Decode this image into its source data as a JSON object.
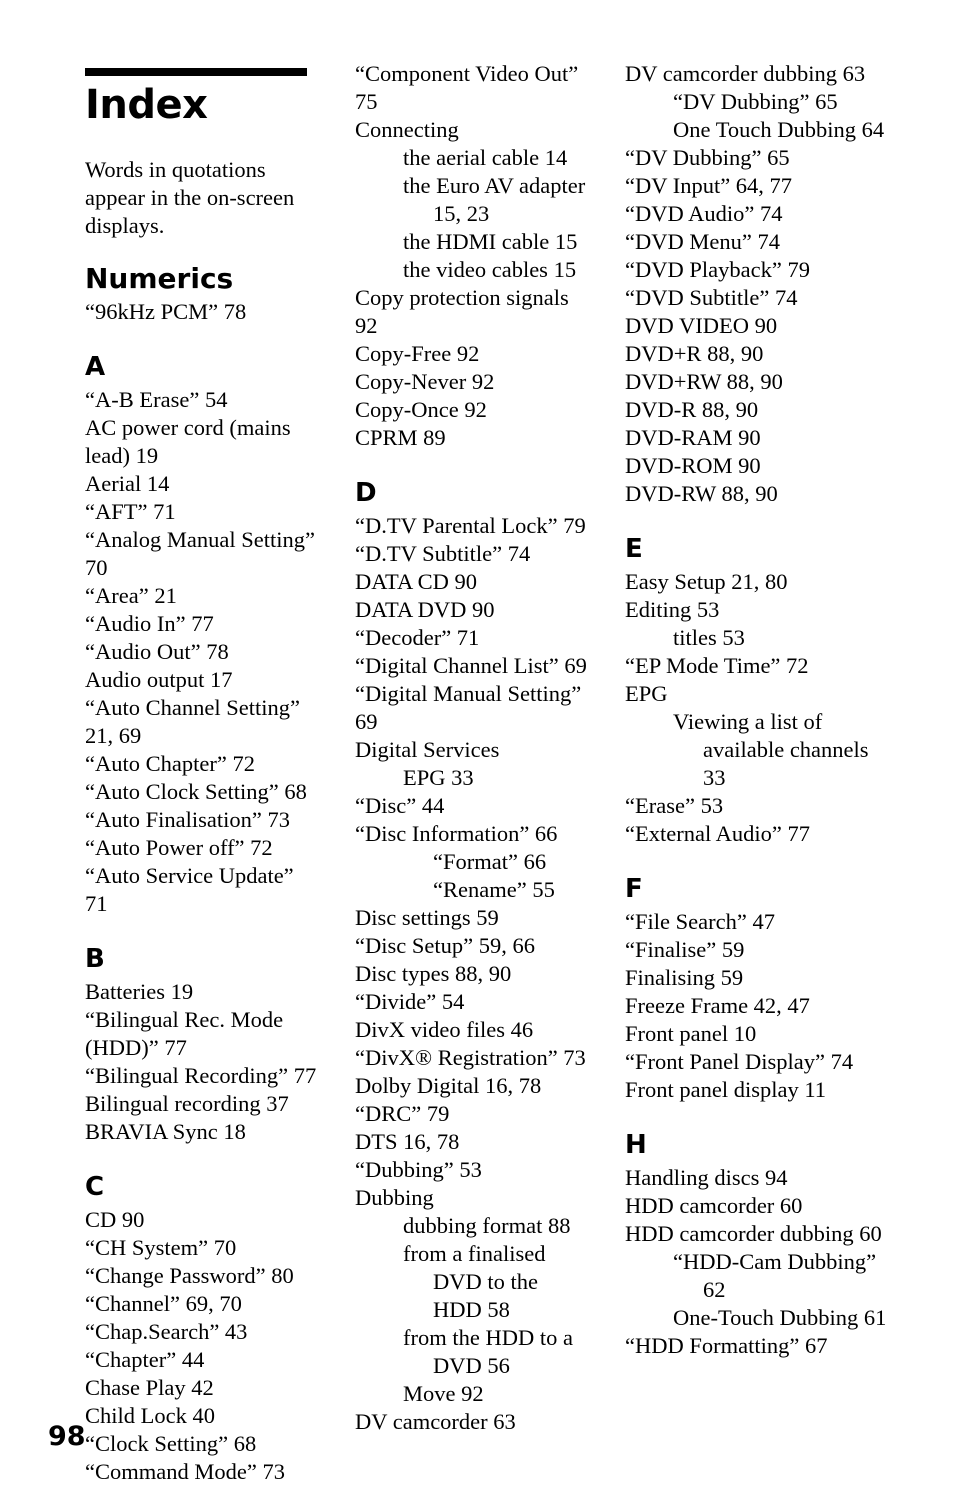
{
  "page": {
    "folio": "98",
    "title": "Index",
    "intro": "Words in quotations appear in the on-screen displays."
  },
  "columns": [
    {
      "blocks": [
        {
          "heading": "Numerics",
          "heading_style": "numerics",
          "entries": [
            {
              "text": "“96kHz PCM” 78",
              "level": 0
            }
          ]
        },
        {
          "heading": "A",
          "heading_style": "letter",
          "entries": [
            {
              "text": "“A-B Erase” 54",
              "level": 0
            },
            {
              "text": "AC power cord (mains lead) 19",
              "level": 0
            },
            {
              "text": "Aerial 14",
              "level": 0
            },
            {
              "text": "“AFT” 71",
              "level": 0
            },
            {
              "text": "“Analog Manual Setting” 70",
              "level": 0
            },
            {
              "text": "“Area” 21",
              "level": 0
            },
            {
              "text": "“Audio In” 77",
              "level": 0
            },
            {
              "text": "“Audio Out” 78",
              "level": 0
            },
            {
              "text": "Audio output 17",
              "level": 0
            },
            {
              "text": "“Auto Channel Setting” 21, 69",
              "level": 0
            },
            {
              "text": "“Auto Chapter” 72",
              "level": 0
            },
            {
              "text": "“Auto Clock Setting” 68",
              "level": 0
            },
            {
              "text": "“Auto Finalisation” 73",
              "level": 0
            },
            {
              "text": "“Auto Power off” 72",
              "level": 0
            },
            {
              "text": "“Auto Service Update” 71",
              "level": 0
            }
          ]
        },
        {
          "heading": "B",
          "heading_style": "letter",
          "entries": [
            {
              "text": "Batteries 19",
              "level": 0
            },
            {
              "text": "“Bilingual Rec. Mode (HDD)” 77",
              "level": 0
            },
            {
              "text": "“Bilingual Recording” 77",
              "level": 0
            },
            {
              "text": "Bilingual recording 37",
              "level": 0
            },
            {
              "text": "BRAVIA Sync 18",
              "level": 0
            }
          ]
        },
        {
          "heading": "C",
          "heading_style": "letter",
          "entries": [
            {
              "text": "CD 90",
              "level": 0
            },
            {
              "text": "“CH System” 70",
              "level": 0
            },
            {
              "text": "“Change Password” 80",
              "level": 0
            },
            {
              "text": "“Channel” 69, 70",
              "level": 0
            },
            {
              "text": "“Chap.Search” 43",
              "level": 0
            },
            {
              "text": "“Chapter” 44",
              "level": 0
            },
            {
              "text": "Chase Play 42",
              "level": 0
            },
            {
              "text": "Child Lock 40",
              "level": 0
            },
            {
              "text": "“Clock Setting” 68",
              "level": 0
            },
            {
              "text": "“Command Mode” 73",
              "level": 0
            }
          ]
        }
      ]
    },
    {
      "blocks": [
        {
          "heading": null,
          "heading_style": null,
          "entries": [
            {
              "text": "“Component Video Out” 75",
              "level": 0
            },
            {
              "text": "Connecting",
              "level": 0
            },
            {
              "text": "the aerial cable 14",
              "level": 1
            },
            {
              "text": "the Euro AV adapter 15, 23",
              "level": 1,
              "wrap_level": 2
            },
            {
              "text": "the HDMI cable 15",
              "level": 1
            },
            {
              "text": "the video cables 15",
              "level": 1
            },
            {
              "text": "Copy protection signals 92",
              "level": 0
            },
            {
              "text": "Copy-Free 92",
              "level": 0
            },
            {
              "text": "Copy-Never 92",
              "level": 0
            },
            {
              "text": "Copy-Once 92",
              "level": 0
            },
            {
              "text": "CPRM 89",
              "level": 0
            }
          ]
        },
        {
          "heading": "D",
          "heading_style": "letter",
          "entries": [
            {
              "text": "“D.TV Parental Lock” 79",
              "level": 0
            },
            {
              "text": "“D.TV Subtitle” 74",
              "level": 0
            },
            {
              "text": "DATA CD 90",
              "level": 0
            },
            {
              "text": "DATA DVD 90",
              "level": 0
            },
            {
              "text": "“Decoder” 71",
              "level": 0
            },
            {
              "text": "“Digital Channel List” 69",
              "level": 0
            },
            {
              "text": "“Digital Manual Setting” 69",
              "level": 0
            },
            {
              "text": "Digital Services",
              "level": 0
            },
            {
              "text": "EPG 33",
              "level": 1
            },
            {
              "text": "“Disc” 44",
              "level": 0
            },
            {
              "text": "“Disc Information” 66",
              "level": 0
            },
            {
              "text": "“Format” 66",
              "level": 2
            },
            {
              "text": "“Rename” 55",
              "level": 2
            },
            {
              "text": "Disc settings 59",
              "level": 0
            },
            {
              "text": "“Disc Setup” 59, 66",
              "level": 0
            },
            {
              "text": "Disc types 88, 90",
              "level": 0
            },
            {
              "text": "“Divide” 54",
              "level": 0
            },
            {
              "text": "DivX video files 46",
              "level": 0
            },
            {
              "text": "“DivX® Registration” 73",
              "level": 0
            },
            {
              "text": "Dolby Digital 16, 78",
              "level": 0
            },
            {
              "text": "“DRC” 79",
              "level": 0
            },
            {
              "text": "DTS 16, 78",
              "level": 0
            },
            {
              "text": "“Dubbing” 53",
              "level": 0
            },
            {
              "text": "Dubbing",
              "level": 0
            },
            {
              "text": "dubbing format 88",
              "level": 1
            },
            {
              "text": "from a finalised DVD to the HDD 58",
              "level": 1,
              "wrap_level": 2
            },
            {
              "text": "from the HDD to a DVD 56",
              "level": 1,
              "wrap_level": 2
            },
            {
              "text": "Move 92",
              "level": 1
            },
            {
              "text": "DV camcorder 63",
              "level": 0
            }
          ]
        }
      ]
    },
    {
      "blocks": [
        {
          "heading": null,
          "heading_style": null,
          "entries": [
            {
              "text": "DV camcorder dubbing 63",
              "level": 0
            },
            {
              "text": "“DV Dubbing” 65",
              "level": 1
            },
            {
              "text": "One Touch Dubbing 64",
              "level": 1,
              "wrap_level": 2
            },
            {
              "text": "“DV Dubbing” 65",
              "level": 0
            },
            {
              "text": "“DV Input” 64, 77",
              "level": 0
            },
            {
              "text": "“DVD Audio” 74",
              "level": 0
            },
            {
              "text": "“DVD Menu” 74",
              "level": 0
            },
            {
              "text": "“DVD Playback” 79",
              "level": 0
            },
            {
              "text": "“DVD Subtitle” 74",
              "level": 0
            },
            {
              "text": "DVD VIDEO 90",
              "level": 0
            },
            {
              "text": "DVD+R 88, 90",
              "level": 0
            },
            {
              "text": "DVD+RW 88, 90",
              "level": 0
            },
            {
              "text": "DVD-R 88, 90",
              "level": 0
            },
            {
              "text": "DVD-RAM 90",
              "level": 0
            },
            {
              "text": "DVD-ROM 90",
              "level": 0
            },
            {
              "text": "DVD-RW 88, 90",
              "level": 0
            }
          ]
        },
        {
          "heading": "E",
          "heading_style": "letter",
          "entries": [
            {
              "text": "Easy Setup 21, 80",
              "level": 0
            },
            {
              "text": "Editing 53",
              "level": 0
            },
            {
              "text": "titles 53",
              "level": 1
            },
            {
              "text": "“EP Mode Time” 72",
              "level": 0
            },
            {
              "text": "EPG",
              "level": 0
            },
            {
              "text": "Viewing a list of available channels 33",
              "level": 1,
              "wrap_level": 2
            },
            {
              "text": "“Erase” 53",
              "level": 0
            },
            {
              "text": "“External Audio” 77",
              "level": 0
            }
          ]
        },
        {
          "heading": "F",
          "heading_style": "letter",
          "entries": [
            {
              "text": "“File Search” 47",
              "level": 0
            },
            {
              "text": "“Finalise” 59",
              "level": 0
            },
            {
              "text": "Finalising 59",
              "level": 0
            },
            {
              "text": "Freeze Frame 42, 47",
              "level": 0
            },
            {
              "text": "Front panel 10",
              "level": 0
            },
            {
              "text": "“Front Panel Display” 74",
              "level": 0
            },
            {
              "text": "Front panel display 11",
              "level": 0
            }
          ]
        },
        {
          "heading": "H",
          "heading_style": "letter",
          "entries": [
            {
              "text": "Handling discs 94",
              "level": 0
            },
            {
              "text": "HDD camcorder 60",
              "level": 0
            },
            {
              "text": "HDD camcorder dubbing 60",
              "level": 0
            },
            {
              "text": "“HDD-Cam Dubbing” 62",
              "level": 1,
              "wrap_level": 2
            },
            {
              "text": "One-Touch Dubbing 61",
              "level": 1,
              "wrap_level": 2
            },
            {
              "text": "“HDD Formatting” 67",
              "level": 0
            }
          ]
        }
      ]
    }
  ]
}
